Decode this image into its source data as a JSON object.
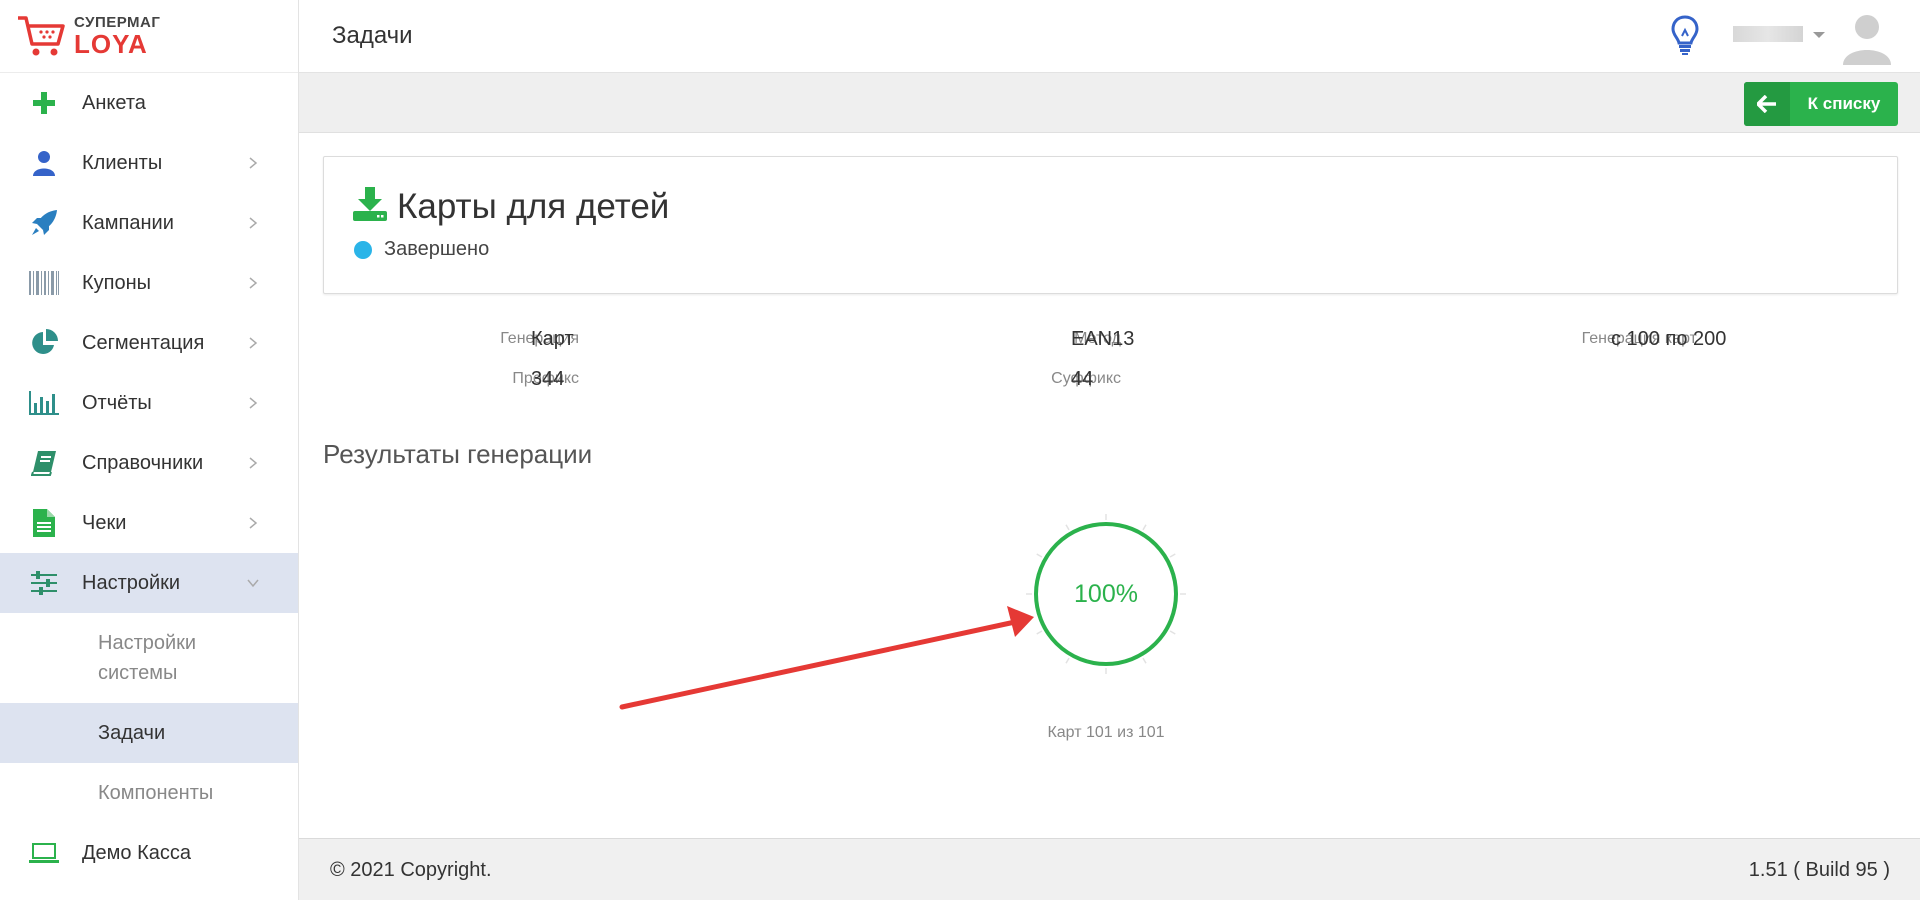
{
  "logo": {
    "line1": "СУПЕРМАГ",
    "line2": "LOYA"
  },
  "header": {
    "title": "Задачи"
  },
  "sidebar": {
    "items": [
      {
        "label": "Анкета",
        "icon": "plus-icon"
      },
      {
        "label": "Клиенты",
        "icon": "user-icon"
      },
      {
        "label": "Кампании",
        "icon": "rocket-icon"
      },
      {
        "label": "Купоны",
        "icon": "barcode-icon"
      },
      {
        "label": "Сегментация",
        "icon": "pie-icon"
      },
      {
        "label": "Отчёты",
        "icon": "bar-chart-icon"
      },
      {
        "label": "Справочники",
        "icon": "book-icon"
      },
      {
        "label": "Чеки",
        "icon": "file-icon"
      },
      {
        "label": "Настройки",
        "icon": "sliders-icon"
      }
    ],
    "sub_items": [
      {
        "label": "Настройки системы"
      },
      {
        "label": "Задачи"
      },
      {
        "label": "Компоненты"
      }
    ],
    "demo": {
      "label": "Демо Касса",
      "icon": "laptop-icon"
    }
  },
  "actions": {
    "back_label": "К списку"
  },
  "task": {
    "title": "Карты для детей",
    "status": "Завершено",
    "fields": {
      "generation_label": "Генерация",
      "generation_value": "Карт",
      "method_label": "Метод",
      "method_value": "EAN13",
      "cards_label": "Генерация карт",
      "cards_value": "с 100 по 200",
      "prefix_label": "Префикс",
      "prefix_value": "344",
      "suffix_label": "Суффикс",
      "suffix_value": "44"
    }
  },
  "results": {
    "title": "Результаты генерации",
    "percent": 100,
    "percent_text": "100%",
    "caption": "Карт 101 из 101"
  },
  "footer": {
    "copyright": "© 2021 Copyright.",
    "version": "1.51 ( Build 95 )"
  },
  "colors": {
    "accent_green": "#2bb24c",
    "active_bg": "#dde3f0",
    "status_blue": "#2ab4e8",
    "logo_red": "#e53935"
  }
}
